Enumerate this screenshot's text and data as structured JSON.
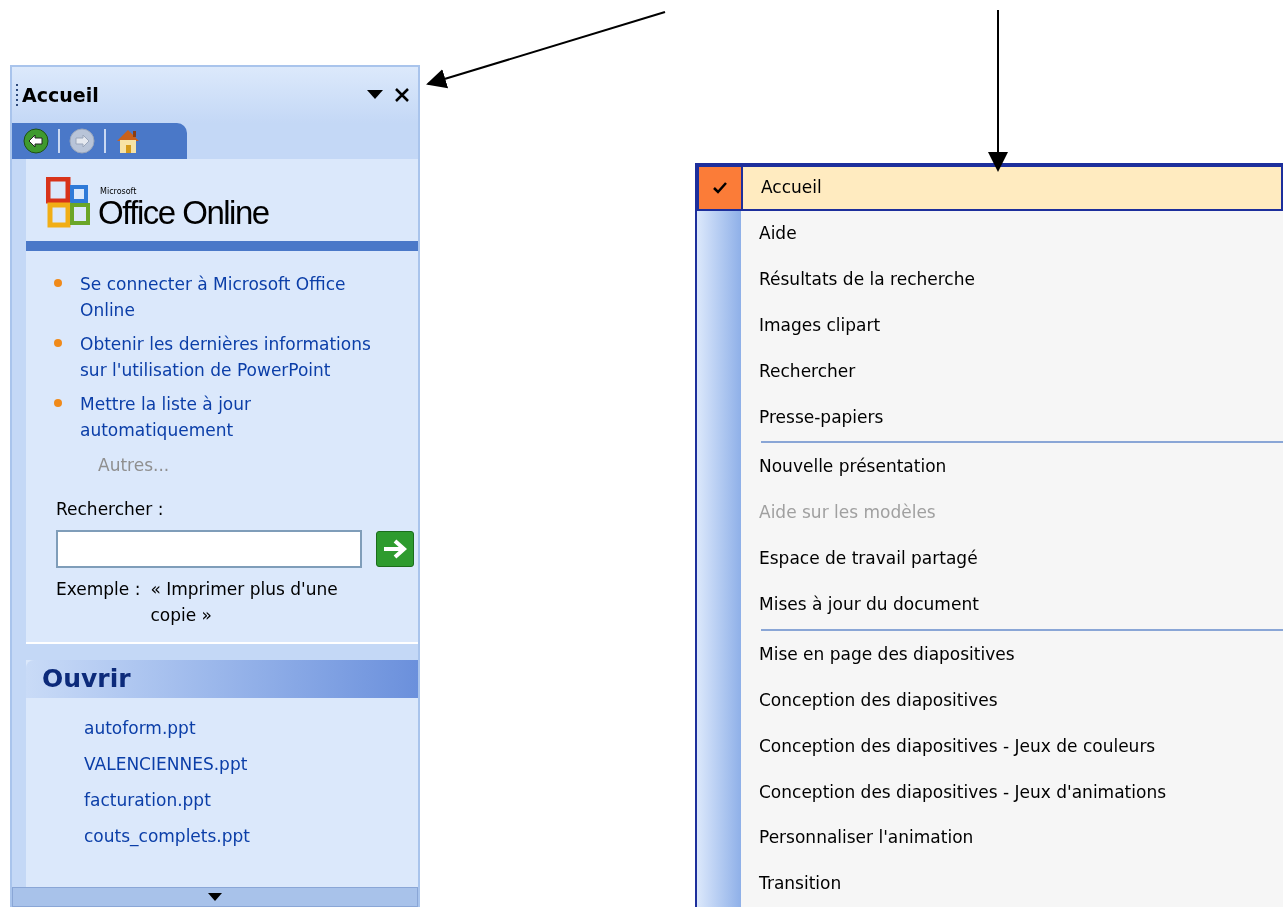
{
  "task_pane": {
    "title": "Accueil",
    "nav": [
      {
        "kind": "back",
        "disabled": false
      },
      {
        "kind": "forward",
        "disabled": true
      },
      {
        "kind": "home",
        "disabled": false
      }
    ],
    "logo": {
      "small": "Microsoft",
      "name": "Office Online"
    },
    "links": [
      "Se connecter à Microsoft Office Online",
      "Obtenir les dernières informations sur l'utilisation de PowerPoint",
      "Mettre la liste à jour automatiquement"
    ],
    "more": "Autres...",
    "search": {
      "label": "Rechercher :",
      "example_label": "Exemple :",
      "example": "« Imprimer plus d'une copie »"
    },
    "open_section": {
      "title": "Ouvrir",
      "files": [
        "autoform.ppt",
        "VALENCIENNES.ppt",
        "facturation.ppt",
        "couts_complets.ppt"
      ]
    }
  },
  "menu": {
    "groups": [
      [
        {
          "label": "Accueil",
          "checked": true,
          "selected": true,
          "disabled": false
        },
        {
          "label": "Aide",
          "checked": false,
          "selected": false,
          "disabled": false
        },
        {
          "label": "Résultats de la recherche",
          "checked": false,
          "selected": false,
          "disabled": false
        },
        {
          "label": "Images clipart",
          "checked": false,
          "selected": false,
          "disabled": false
        },
        {
          "label": "Rechercher",
          "checked": false,
          "selected": false,
          "disabled": false
        },
        {
          "label": "Presse-papiers",
          "checked": false,
          "selected": false,
          "disabled": false
        }
      ],
      [
        {
          "label": "Nouvelle présentation",
          "checked": false,
          "selected": false,
          "disabled": false
        },
        {
          "label": "Aide sur les modèles",
          "checked": false,
          "selected": false,
          "disabled": true
        },
        {
          "label": "Espace de travail partagé",
          "checked": false,
          "selected": false,
          "disabled": false
        },
        {
          "label": "Mises à jour du document",
          "checked": false,
          "selected": false,
          "disabled": false
        }
      ],
      [
        {
          "label": "Mise en page des diapositives",
          "checked": false,
          "selected": false,
          "disabled": false
        },
        {
          "label": "Conception des diapositives",
          "checked": false,
          "selected": false,
          "disabled": false
        },
        {
          "label": "Conception des diapositives - Jeux de couleurs",
          "checked": false,
          "selected": false,
          "disabled": false
        },
        {
          "label": "Conception des diapositives - Jeux d'animations",
          "checked": false,
          "selected": false,
          "disabled": false
        },
        {
          "label": "Personnaliser l'animation",
          "checked": false,
          "selected": false,
          "disabled": false
        },
        {
          "label": "Transition",
          "checked": false,
          "selected": false,
          "disabled": false
        }
      ]
    ]
  }
}
